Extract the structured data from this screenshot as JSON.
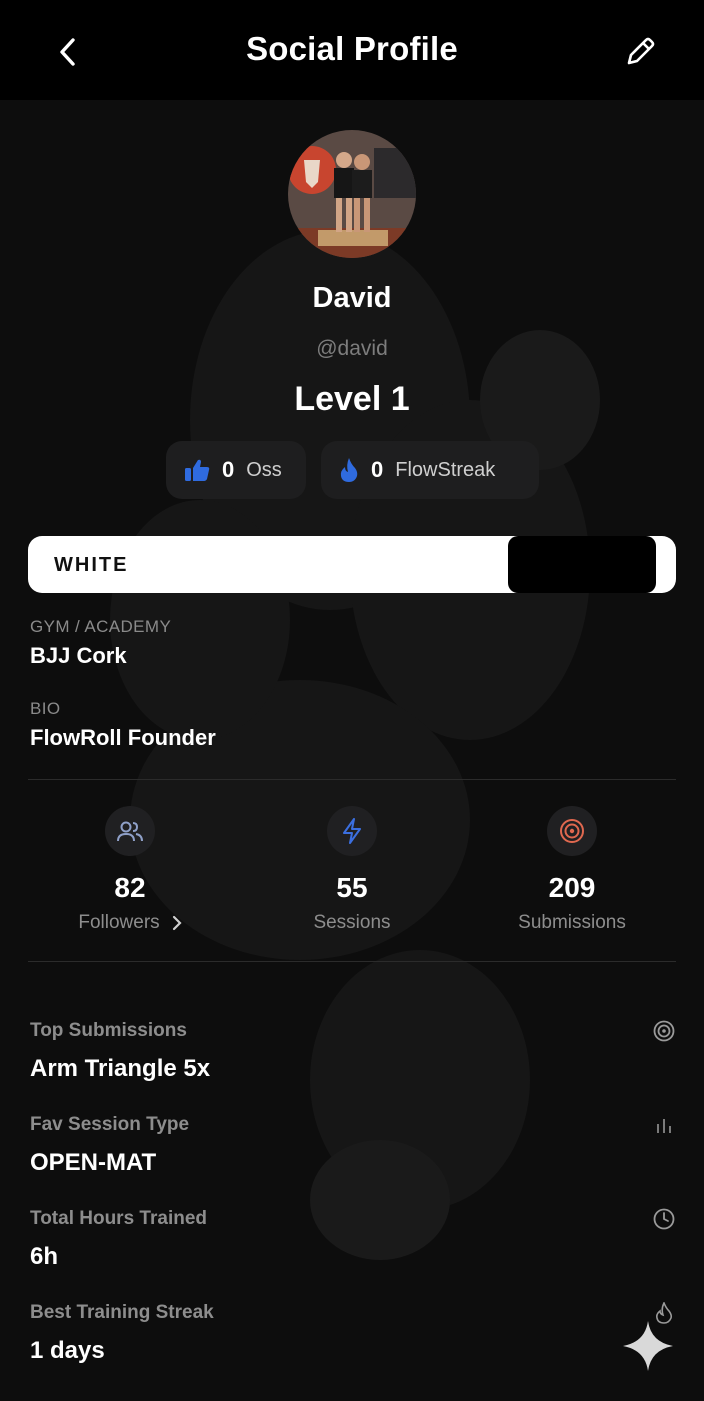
{
  "header": {
    "title": "Social Profile"
  },
  "profile": {
    "name": "David",
    "handle": "@david",
    "level": "Level 1",
    "oss": {
      "count": "0",
      "label": "Oss"
    },
    "flowstreak": {
      "count": "0",
      "label": "FlowStreak"
    },
    "belt": "WHITE",
    "gym_label": "GYM / ACADEMY",
    "gym_value": "BJJ Cork",
    "bio_label": "BIO",
    "bio_value": "FlowRoll Founder"
  },
  "stats": [
    {
      "value": "82",
      "label": "Followers",
      "icon": "users-icon",
      "accent": "#8fa0c8"
    },
    {
      "value": "55",
      "label": "Sessions",
      "icon": "lightning-icon",
      "accent": "#3b6fe0"
    },
    {
      "value": "209",
      "label": "Submissions",
      "icon": "target-icon",
      "accent": "#e0684f"
    }
  ],
  "details": [
    {
      "label": "Top Submissions",
      "value": "Arm Triangle  5x",
      "icon": "target-icon"
    },
    {
      "label": "Fav Session Type",
      "value": "OPEN-MAT",
      "icon": "bar-chart-icon"
    },
    {
      "label": "Total Hours Trained",
      "value": "6h",
      "icon": "clock-icon"
    },
    {
      "label": "Best Training Streak",
      "value": "1 days",
      "icon": "flame-icon"
    }
  ],
  "colors": {
    "background": "#0d0d0d",
    "accent_blue": "#2f6bdf",
    "pill_bg": "#1e1e1f"
  }
}
